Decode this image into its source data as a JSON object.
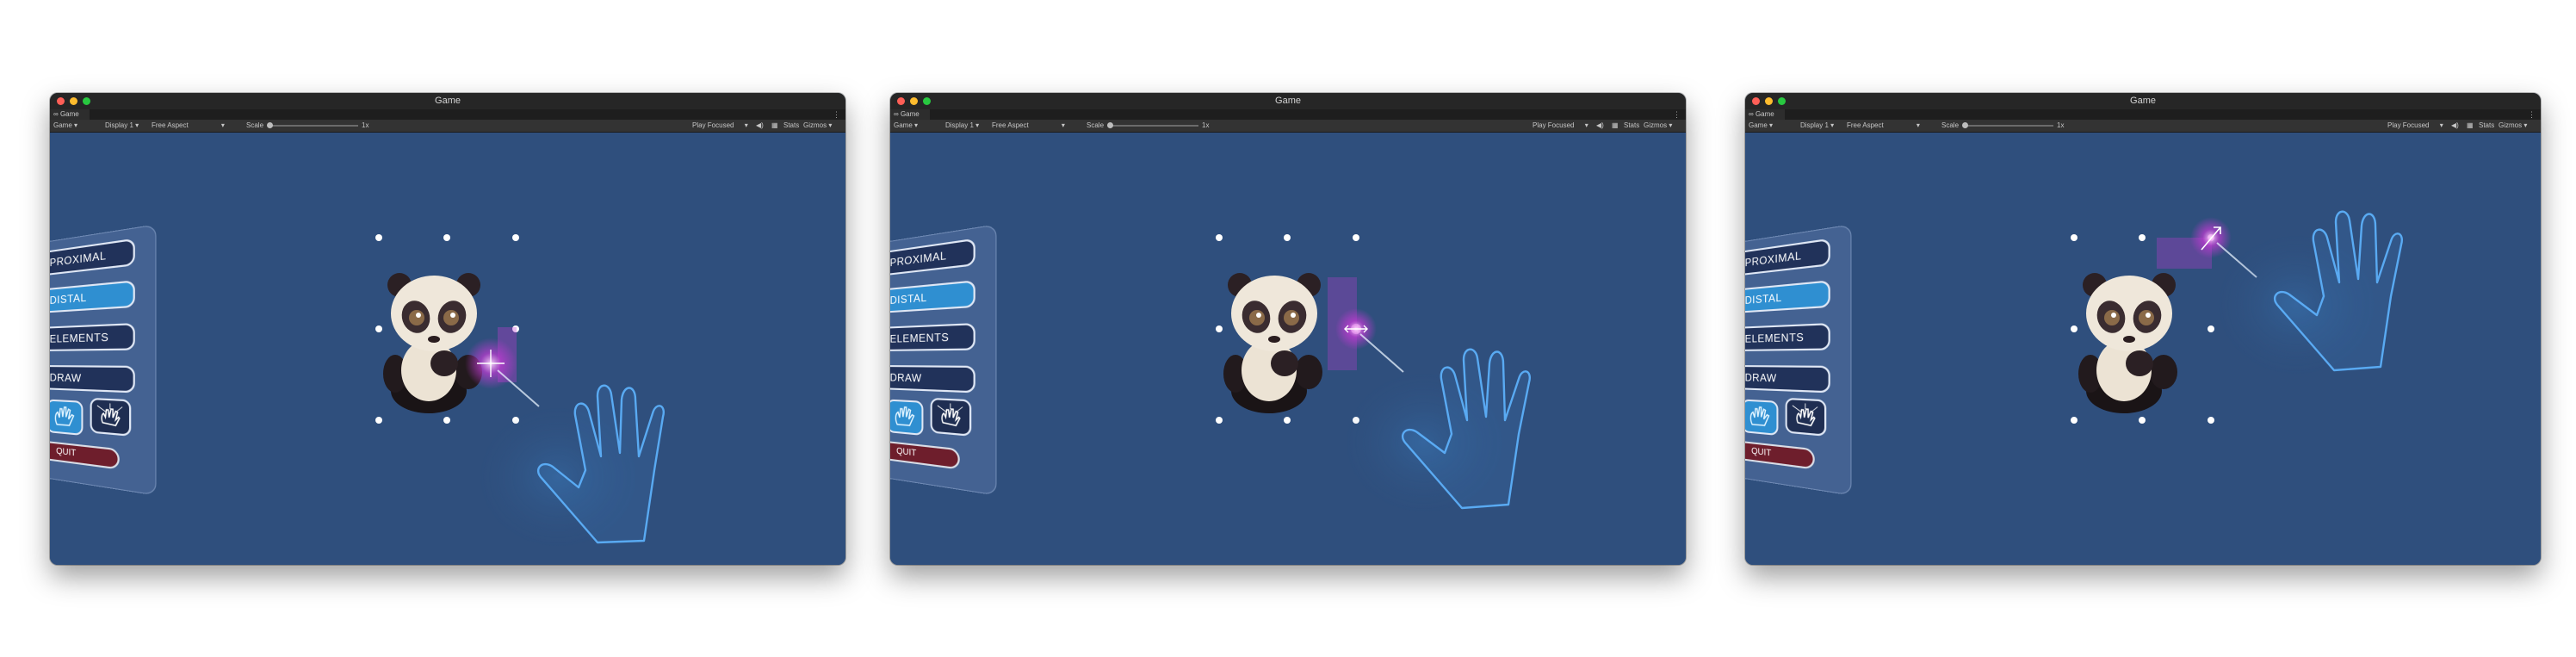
{
  "windows": [
    {
      "title": "Game",
      "tab": "Game",
      "toolbar": {
        "display_mode": "Game",
        "display": "Display 1",
        "aspect": "Free Aspect",
        "scale_label": "Scale",
        "scale_value": "1x",
        "play_mode": "Play Focused",
        "stats": "Stats",
        "gizmos": "Gizmos"
      },
      "menu": {
        "buttons": [
          "PROXIMAL",
          "DISTAL",
          "ELEMENTS",
          "DRAW"
        ],
        "active": "DISTAL",
        "quit": "QUIT"
      },
      "interaction": "scale-from-edge"
    },
    {
      "title": "Game",
      "tab": "Game",
      "toolbar": {
        "display_mode": "Game",
        "display": "Display 1",
        "aspect": "Free Aspect",
        "scale_label": "Scale",
        "scale_value": "1x",
        "play_mode": "Play Focused",
        "stats": "Stats",
        "gizmos": "Gizmos"
      },
      "menu": {
        "buttons": [
          "PROXIMAL",
          "DISTAL",
          "ELEMENTS",
          "DRAW"
        ],
        "active": "DISTAL",
        "quit": "QUIT"
      },
      "interaction": "scale-right-edge"
    },
    {
      "title": "Game",
      "tab": "Game",
      "toolbar": {
        "display_mode": "Game",
        "display": "Display 1",
        "aspect": "Free Aspect",
        "scale_label": "Scale",
        "scale_value": "1x",
        "play_mode": "Play Focused",
        "stats": "Stats",
        "gizmos": "Gizmos"
      },
      "menu": {
        "buttons": [
          "PROXIMAL",
          "DISTAL",
          "ELEMENTS",
          "DRAW"
        ],
        "active": "DISTAL",
        "quit": "QUIT"
      },
      "interaction": "rotate-corner"
    }
  ],
  "colors": {
    "viewport_bg": "#2f4f7d",
    "active_button": "#2f8fd1",
    "button_bg": "#21325a",
    "quit_bg": "#6e1e2c",
    "glow": "#c23bd4"
  }
}
